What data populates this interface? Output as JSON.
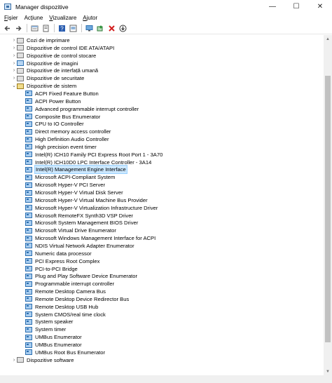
{
  "window": {
    "title": "Manager dispozitive",
    "icon": "device-manager-icon"
  },
  "window_controls": {
    "minimize": "—",
    "maximize": "☐",
    "close": "✕"
  },
  "menu": [
    {
      "pre": "",
      "u": "F",
      "post": "ișier"
    },
    {
      "pre": "Ac",
      "u": "ț",
      "post": "iune"
    },
    {
      "pre": "",
      "u": "V",
      "post": "izualizare"
    },
    {
      "pre": "",
      "u": "A",
      "post": "jutor"
    }
  ],
  "toolbar": [
    "back-icon",
    "forward-icon",
    "properties-icon",
    "update-driver-icon",
    "help-icon",
    "scan-hardware-icon",
    "computer-icon",
    "enable-device-icon",
    "uninstall-device-icon",
    "download-icon"
  ],
  "tree": {
    "categories_before": [
      {
        "label": "Cozi de imprimare",
        "icon": "print-queue-icon",
        "color": "gray"
      },
      {
        "label": "Dispozitive de control IDE ATA/ATAPI",
        "icon": "ide-controller-icon",
        "color": "gray"
      },
      {
        "label": "Dispozitive de control stocare",
        "icon": "storage-controller-icon",
        "color": "gray"
      },
      {
        "label": "Dispozitive de imagini",
        "icon": "imaging-device-icon",
        "color": "blue"
      },
      {
        "label": "Dispozitive de interfață umană",
        "icon": "human-interface-icon",
        "color": "gray"
      },
      {
        "label": "Dispozitive de securitate",
        "icon": "security-device-icon",
        "color": "gray"
      }
    ],
    "expanded_category": {
      "label": "Dispozitive de sistem",
      "icon": "system-devices-icon"
    },
    "system_devices": [
      "ACPI Fixed Feature Button",
      "ACPI Power Button",
      "Advanced programmable interrupt controller",
      "Composite Bus Enumerator",
      "CPU to IO Controller",
      "Direct memory access controller",
      "High Definition Audio Controller",
      "High precision event timer",
      "Intel(R) ICH10 Family PCI Express Root Port 1 - 3A70",
      "Intel(R) ICH10D0 LPC Interface Controller - 3A14",
      "Intel(R) Management Engine Interface",
      "Microsoft ACPI-Compliant System",
      "Microsoft Hyper-V PCI Server",
      "Microsoft Hyper-V Virtual Disk Server",
      "Microsoft Hyper-V Virtual Machine Bus Provider",
      "Microsoft Hyper-V Virtualization Infrastructure Driver",
      "Microsoft RemoteFX Synth3D VSP Driver",
      "Microsoft System Management BIOS Driver",
      "Microsoft Virtual Drive Enumerator",
      "Microsoft Windows Management Interface for ACPI",
      "NDIS Virtual Network Adapter Enumerator",
      "Numeric data processor",
      "PCI Express Root Complex",
      "PCI-to-PCI Bridge",
      "Plug and Play Software Device Enumerator",
      "Programmable interrupt controller",
      "Remote Desktop Camera Bus",
      "Remote Desktop Device Redirector Bus",
      "Remote Desktop USB Hub",
      "System CMOS/real time clock",
      "System speaker",
      "System timer",
      "UMBus Enumerator",
      "UMBus Enumerator",
      "UMBus Root Bus Enumerator"
    ],
    "selected_device": "Intel(R) Management Engine Interface",
    "categories_after": [
      {
        "label": "Dispozitive software",
        "icon": "software-devices-icon",
        "color": "gray"
      }
    ]
  }
}
